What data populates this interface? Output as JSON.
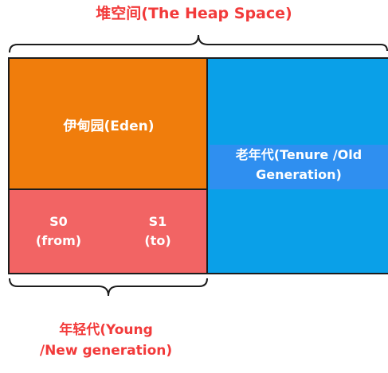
{
  "heap_title": "堆空间(The Heap Space)",
  "eden_label": "伊甸园(Eden)",
  "s0": {
    "line1": "S0",
    "line2": "(from)"
  },
  "s1": {
    "line1": "S1",
    "line2": "(to)"
  },
  "tenure": {
    "line1": "老年代(Tenure /Old",
    "line2": "Generation)"
  },
  "young": {
    "line1": "年轻代(Young",
    "line2": "/New generation)"
  },
  "colors": {
    "eden": "#f07d0c",
    "survivor": "#f26464",
    "tenure": "#0aa0e8",
    "label_red": "#f23a3a"
  }
}
